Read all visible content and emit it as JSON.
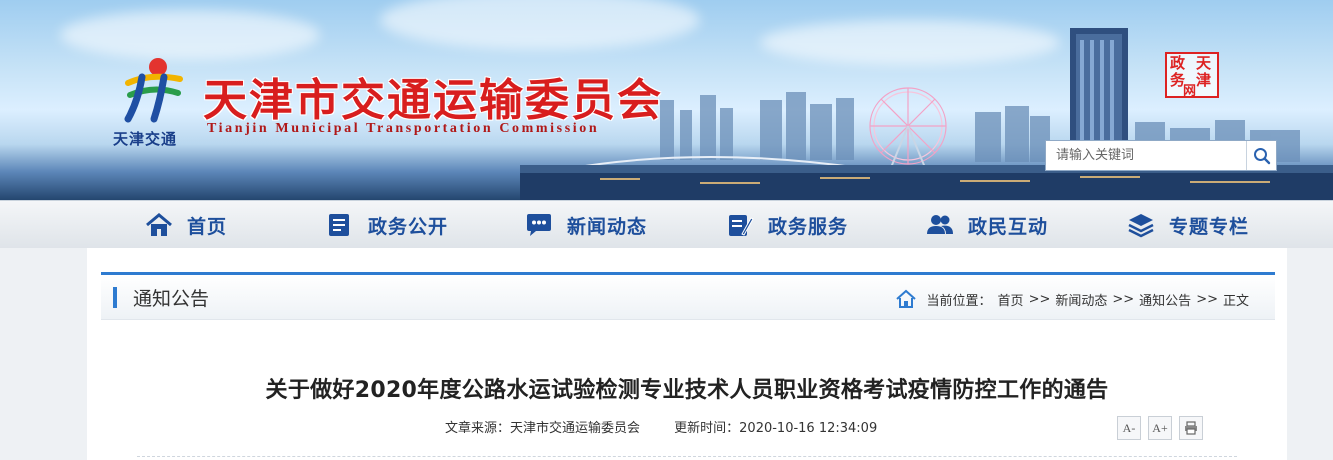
{
  "header": {
    "logo_text": "天津交通",
    "site_title": "天津市交通运输委员会",
    "site_title_en": "Tianjin Municipal Transportation Commission",
    "seal_text": [
      "天",
      "津",
      "政",
      "务",
      "网"
    ],
    "search": {
      "placeholder": "请输入关键词"
    }
  },
  "nav": {
    "items": [
      {
        "label": "首页",
        "icon": "home-icon"
      },
      {
        "label": "政务公开",
        "icon": "document-icon"
      },
      {
        "label": "新闻动态",
        "icon": "chat-icon"
      },
      {
        "label": "政务服务",
        "icon": "service-icon"
      },
      {
        "label": "政民互动",
        "icon": "users-icon"
      },
      {
        "label": "专题专栏",
        "icon": "layers-icon"
      }
    ]
  },
  "section": {
    "title": "通知公告",
    "breadcrumb": {
      "prefix": "当前位置：",
      "items": [
        "首页",
        "新闻动态",
        "通知公告",
        "正文"
      ],
      "separator": ">>"
    }
  },
  "article": {
    "title": "关于做好2020年度公路水运试验检测专业技术人员职业资格考试疫情防控工作的通告",
    "source": "文章来源：天津市交通运输委员会",
    "updated": "更新时间：2020-10-16 12:34:09",
    "tools": {
      "font_smaller": "A-",
      "font_larger": "A+",
      "print": "print-icon"
    }
  },
  "colors": {
    "nav_text": "#1e4f9c",
    "title_red": "#d81e1e",
    "accent_blue": "#2e7bd0"
  }
}
